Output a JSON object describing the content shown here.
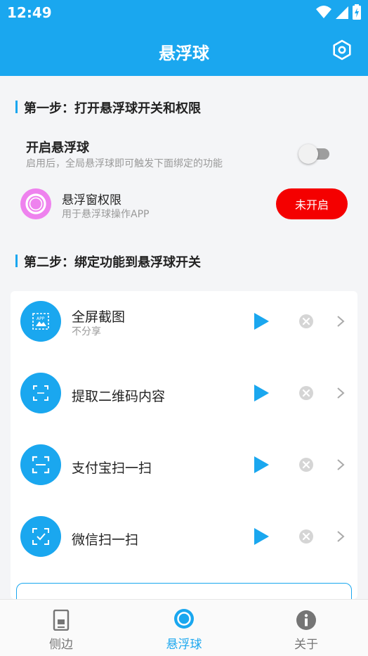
{
  "status_bar": {
    "time": "12:49"
  },
  "header": {
    "title": "悬浮球"
  },
  "step1": {
    "title": "第一步：打开悬浮球开关和权限",
    "float_switch": {
      "title": "开启悬浮球",
      "subtitle": "启用后，全局悬浮球即可触发下面绑定的功能",
      "enabled": false
    },
    "overlay_permission": {
      "title": "悬浮窗权限",
      "subtitle": "用于悬浮球操作APP",
      "button": "未开启"
    }
  },
  "step2": {
    "title": "第二步：绑定功能到悬浮球开关",
    "functions": [
      {
        "title": "全屏截图",
        "subtitle": "不分享",
        "icon": "screenshot-icon"
      },
      {
        "title": "提取二维码内容",
        "subtitle": "",
        "icon": "qr-scan-icon"
      },
      {
        "title": "支付宝扫一扫",
        "subtitle": "",
        "icon": "scan-icon"
      },
      {
        "title": "微信扫一扫",
        "subtitle": "",
        "icon": "wechat-scan-icon"
      }
    ]
  },
  "bottom_nav": [
    {
      "label": "侧边",
      "icon": "phone-sidebar-icon",
      "active": false
    },
    {
      "label": "悬浮球",
      "icon": "float-ball-icon",
      "active": true
    },
    {
      "label": "关于",
      "icon": "info-icon",
      "active": false
    }
  ],
  "colors": {
    "primary": "#1aa7ef",
    "danger": "#f40000",
    "permission_icon": "#ee82ee"
  }
}
